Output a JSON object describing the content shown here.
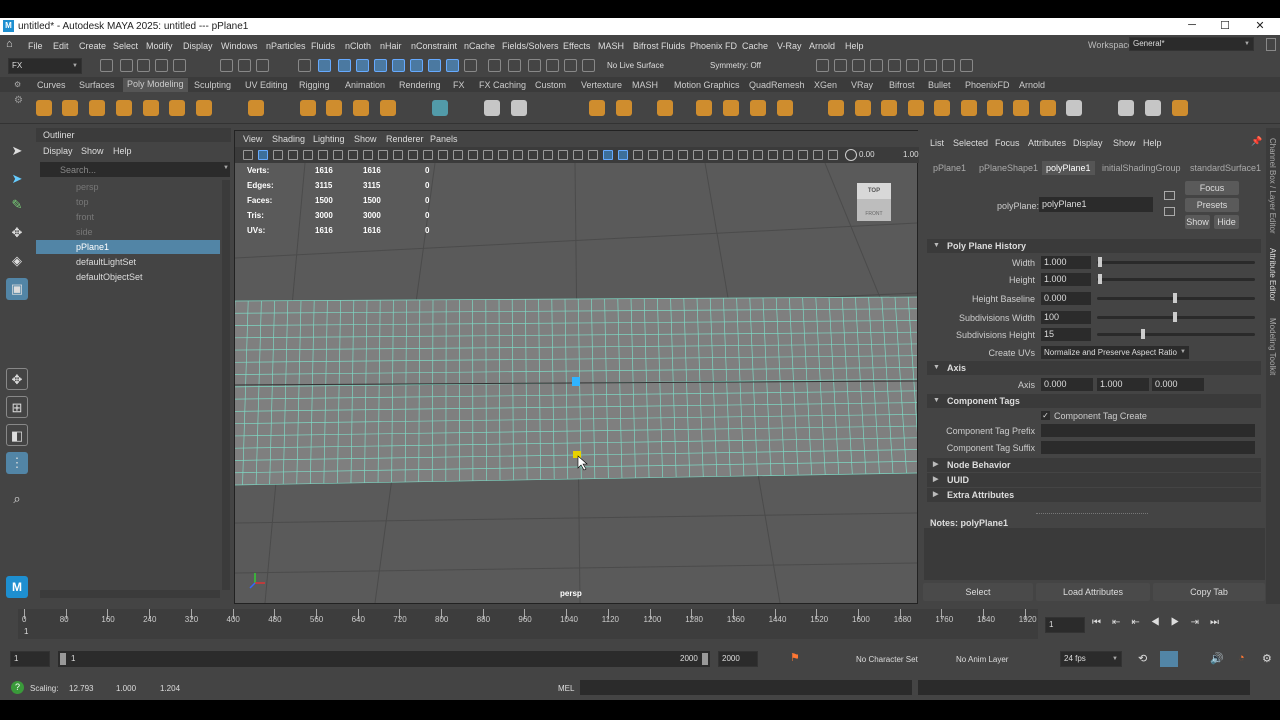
{
  "title": {
    "text": "untitled* - Autodesk MAYA 2025: untitled   ---   pPlane1",
    "app_icon": "M"
  },
  "menus": [
    "File",
    "Edit",
    "Create",
    "Select",
    "Modify",
    "Display",
    "Windows",
    "nParticles",
    "Fluids",
    "nCloth",
    "nHair",
    "nConstraint",
    "nCache",
    "Fields/Solvers",
    "Effects",
    "MASH",
    "Bifrost Fluids",
    "Phoenix FD",
    "Cache",
    "V-Ray",
    "Arnold",
    "Help"
  ],
  "workspace": {
    "label": "Workspace:",
    "value": "General*"
  },
  "statusline": {
    "menu_set": "FX",
    "live_surface": "No Live Surface",
    "symmetry": "Symmetry: Off"
  },
  "shelf_tabs": [
    "Curves",
    "Surfaces",
    "Poly Modeling",
    "Sculpting",
    "UV Editing",
    "Rigging",
    "Animation",
    "Rendering",
    "FX",
    "FX Caching",
    "Custom",
    "Vertexture",
    "MASH",
    "Motion Graphics",
    "QuadRemesh",
    "XGen",
    "VRay",
    "Bifrost",
    "Bullet",
    "PhoenixFD",
    "Arnold"
  ],
  "active_shelf": "Poly Modeling",
  "outliner": {
    "title": "Outliner",
    "menu": [
      "Display",
      "Show",
      "Help"
    ],
    "search_placeholder": "Search...",
    "items": [
      {
        "label": "persp",
        "dim": true
      },
      {
        "label": "top",
        "dim": true
      },
      {
        "label": "front",
        "dim": true
      },
      {
        "label": "side",
        "dim": true
      },
      {
        "label": "pPlane1",
        "selected": true
      },
      {
        "label": "defaultLightSet"
      },
      {
        "label": "defaultObjectSet"
      }
    ]
  },
  "viewport": {
    "menu": [
      "View",
      "Shading",
      "Lighting",
      "Show",
      "Renderer",
      "Panels"
    ],
    "camera_label": "persp",
    "near_clip": "0.00",
    "scale_value": "1.00",
    "viewcube": {
      "top": "TOP",
      "front": "FRONT"
    },
    "hud": [
      {
        "label": "Verts:",
        "a": "1616",
        "b": "1616",
        "c": "0"
      },
      {
        "label": "Edges:",
        "a": "3115",
        "b": "3115",
        "c": "0"
      },
      {
        "label": "Faces:",
        "a": "1500",
        "b": "1500",
        "c": "0"
      },
      {
        "label": "Tris:",
        "a": "3000",
        "b": "3000",
        "c": "0"
      },
      {
        "label": "UVs:",
        "a": "1616",
        "b": "1616",
        "c": "0"
      }
    ]
  },
  "attribute_editor": {
    "menu": [
      "List",
      "Selected",
      "Focus",
      "Attributes",
      "Display",
      "Show",
      "Help"
    ],
    "tabs": [
      "pPlane1",
      "pPlaneShape1",
      "polyPlane1",
      "initialShadingGroup",
      "standardSurface1"
    ],
    "active_tab": "polyPlane1",
    "node_label": "polyPlane:",
    "node_value": "polyPlane1",
    "buttons": {
      "focus": "Focus",
      "presets": "Presets",
      "show": "Show",
      "hide": "Hide"
    },
    "section_history": "Poly Plane History",
    "width_label": "Width",
    "width_value": "1.000",
    "height_label": "Height",
    "height_value": "1.000",
    "baseline_label": "Height Baseline",
    "baseline_value": "0.000",
    "subw_label": "Subdivisions Width",
    "subw_value": "100",
    "subh_label": "Subdivisions Height",
    "subh_value": "15",
    "create_uvs_label": "Create UVs",
    "create_uvs_value": "Normalize and Preserve Aspect Ratio",
    "section_axis": "Axis",
    "axis_label": "Axis",
    "axis_x": "0.000",
    "axis_y": "1.000",
    "axis_z": "0.000",
    "section_tags": "Component Tags",
    "tag_create": "Component Tag Create",
    "tag_prefix": "Component Tag Prefix",
    "tag_suffix": "Component Tag Suffix",
    "section_node": "Node Behavior",
    "section_uuid": "UUID",
    "section_extra": "Extra Attributes",
    "notes": "Notes:  polyPlane1",
    "bottom": {
      "select": "Select",
      "load": "Load Attributes",
      "copy": "Copy Tab"
    }
  },
  "side_tabs": [
    "Channel Box / Layer Editor",
    "Attribute Editor",
    "Modeling Toolkit"
  ],
  "timeline": {
    "ticks": [
      "0",
      "80",
      "160",
      "240",
      "320",
      "400",
      "480",
      "560",
      "640",
      "720",
      "800",
      "880",
      "960",
      "1040",
      "1120",
      "1200",
      "1280",
      "1360",
      "1440",
      "1520",
      "1600",
      "1680",
      "1760",
      "1840",
      "1920"
    ],
    "current_frame": "1",
    "frame_field": "1"
  },
  "range": {
    "start": "1",
    "inner_start": "1",
    "inner_end": "2000",
    "end": "2000",
    "character_set": "No Character Set",
    "anim_layer": "No Anim Layer",
    "fps": "24 fps"
  },
  "status": {
    "scaling_label": "Scaling:",
    "x": "12.793",
    "y": "1.000",
    "z": "1.204",
    "mel": "MEL"
  }
}
